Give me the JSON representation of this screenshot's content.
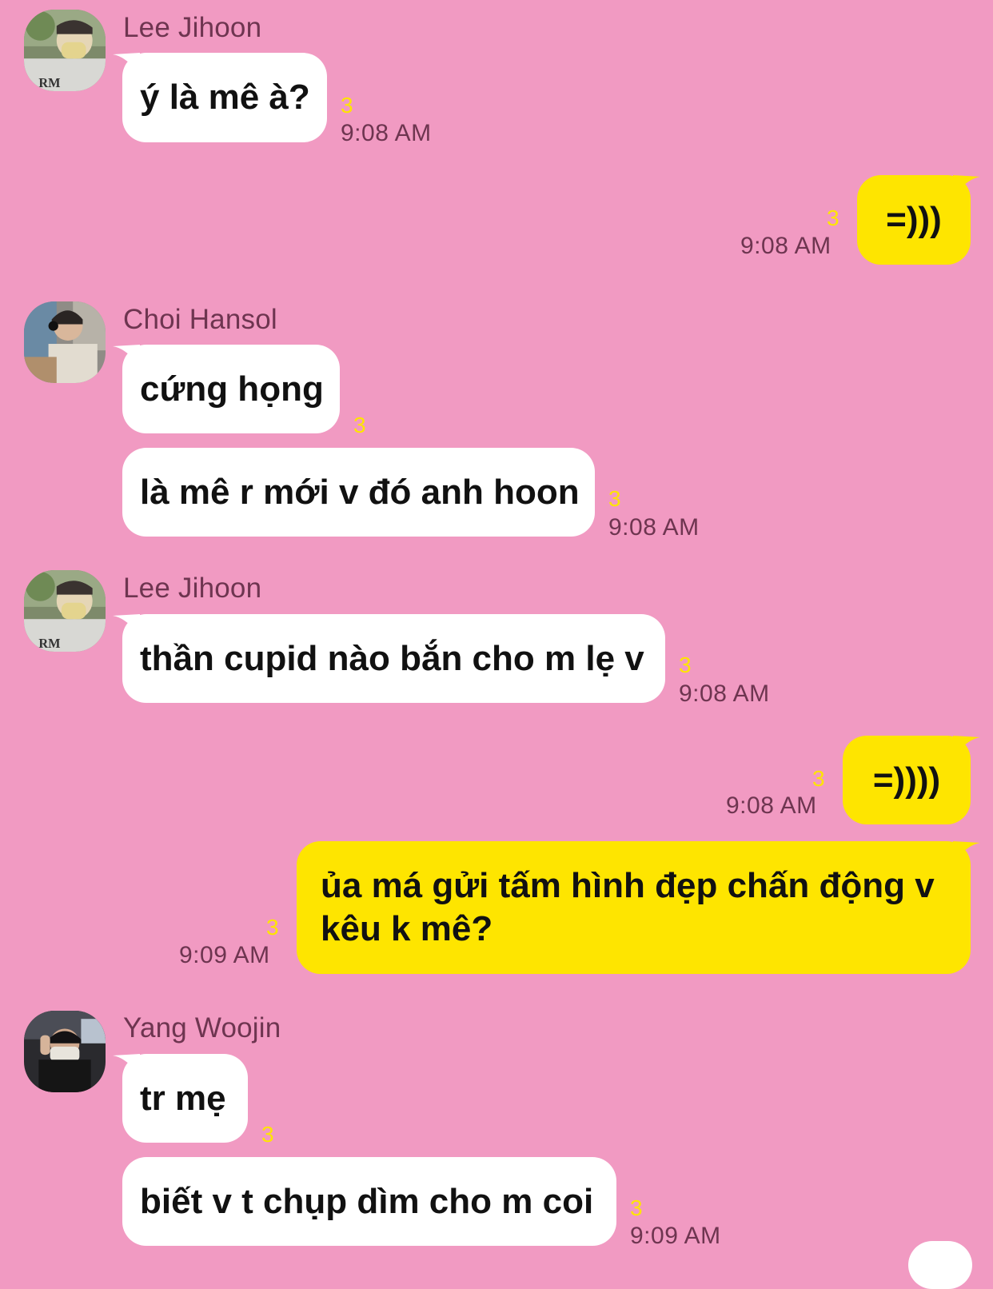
{
  "messages": [
    {
      "sender": "Lee Jihoon",
      "text": "ý là mê à?",
      "unread": "3",
      "time": "9:08 AM"
    },
    {
      "text": "=)))",
      "unread": "3",
      "time": "9:08 AM"
    },
    {
      "sender": "Choi Hansol",
      "text": "cứng họng",
      "unread": "3"
    },
    {
      "text": "là mê r mới v đó anh hoon",
      "unread": "3",
      "time": "9:08 AM"
    },
    {
      "sender": "Lee Jihoon",
      "text": "thần cupid nào bắn cho m lẹ v",
      "unread": "3",
      "time": "9:08 AM"
    },
    {
      "text": "=))))",
      "unread": "3",
      "time": "9:08 AM"
    },
    {
      "text": "ủa má gửi tấm hình đẹp chấn động v kêu k mê?",
      "unread": "3",
      "time": "9:09 AM"
    },
    {
      "sender": "Yang Woojin",
      "text": "tr mẹ",
      "unread": "3"
    },
    {
      "text": "biết v t chụp dìm cho m coi",
      "unread": "3",
      "time": "9:09 AM"
    }
  ],
  "colors": {
    "background": "#f19ac2",
    "incoming_bubble": "#ffffff",
    "outgoing_bubble": "#fee500",
    "unread": "#fee500",
    "meta_text": "#6e3550"
  }
}
